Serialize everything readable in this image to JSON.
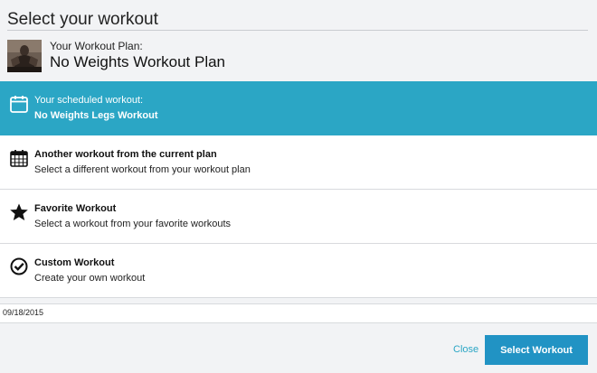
{
  "dialog": {
    "title": "Select your workout"
  },
  "plan": {
    "caption": "Your Workout Plan:",
    "name": "No Weights Workout Plan",
    "thumbnail_icon": "athlete-photo"
  },
  "options": [
    {
      "title": "Your scheduled workout:",
      "subtitle": "No Weights Legs Workout",
      "icon": "calendar-icon",
      "selected": true
    },
    {
      "title": "Another workout from the current plan",
      "subtitle": "Select a different workout from your workout plan",
      "icon": "calendar-grid-icon",
      "selected": false
    },
    {
      "title": "Favorite Workout",
      "subtitle": "Select a workout from your favorite workouts",
      "icon": "star-icon",
      "selected": false
    },
    {
      "title": "Custom Workout",
      "subtitle": "Create your own workout",
      "icon": "check-circle-icon",
      "selected": false
    }
  ],
  "date": {
    "value": "09/18/2015"
  },
  "footer": {
    "close_label": "Close",
    "select_label": "Select Workout"
  },
  "colors": {
    "accent": "#2ba6c5",
    "button": "#2193c4",
    "background": "#f2f3f5"
  }
}
